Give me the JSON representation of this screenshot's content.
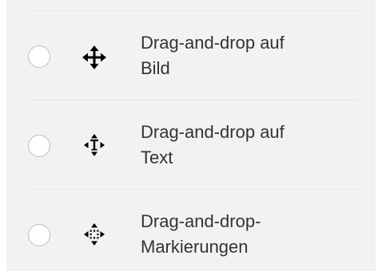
{
  "options": [
    {
      "label_line1": "Drag-and-drop auf",
      "label_line2": "Bild",
      "icon": "move-arrows-icon"
    },
    {
      "label_line1": "Drag-and-drop auf",
      "label_line2": "Text",
      "icon": "move-text-icon"
    },
    {
      "label_line1": "Drag-and-drop-",
      "label_line2": "Markierungen",
      "icon": "move-markers-icon"
    }
  ]
}
